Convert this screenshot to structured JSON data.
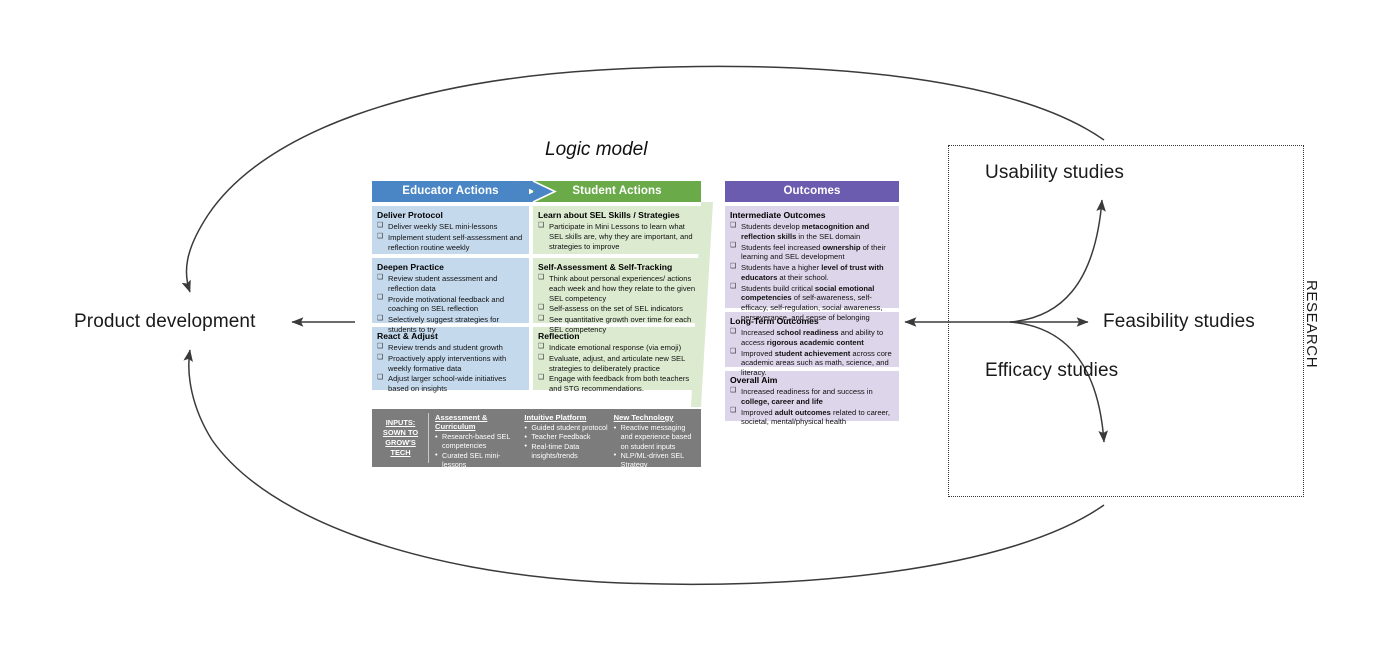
{
  "diagram": {
    "title_logic_model": "Logic model",
    "research_label": "RESEARCH",
    "outer": {
      "product_development": "Product development",
      "usability_studies": "Usability studies",
      "feasibility_studies": "Feasibility studies",
      "efficacy_studies": "Efficacy studies"
    },
    "colors": {
      "educator_header": "#4a86c5",
      "student_header": "#6aaa49",
      "outcomes_header": "#6c5cb0",
      "educator_cell": "#c5d9ed",
      "student_cell": "#dcead0",
      "outcomes_cell": "#ddd5ea",
      "inputs_bar": "#7c7c7c",
      "line": "#3a3a3a"
    }
  },
  "columns": {
    "educator": {
      "header": "Educator Actions",
      "cells": [
        {
          "title": "Deliver Protocol",
          "items": [
            "Deliver weekly SEL mini-lessons",
            "Implement student self-assessment and reflection routine weekly"
          ]
        },
        {
          "title": "Deepen Practice",
          "items": [
            "Review student assessment and reflection data",
            "Provide motivational feedback and coaching on SEL reflection",
            "Selectively suggest strategies for students to try"
          ]
        },
        {
          "title": "React &amp; Adjust",
          "items": [
            "Review trends and student growth",
            "Proactively apply interventions with weekly formative data",
            "Adjust larger school-wide initiatives based on insights"
          ]
        }
      ]
    },
    "student": {
      "header": "Student Actions",
      "cells": [
        {
          "title": "Learn about SEL Skills / Strategies",
          "items": [
            "Participate in Mini Lessons to learn what SEL skills are, why they are important, and strategies to improve"
          ]
        },
        {
          "title": "Self-Assessment &amp; Self-Tracking",
          "items": [
            "Think about personal experiences/ actions each week and how they relate to the given SEL competency",
            "Self-assess on the set of SEL indicators",
            "See quantitative growth over time for each SEL competency"
          ]
        },
        {
          "title": "Reflection",
          "items": [
            "Indicate emotional response (via emoji)",
            "Evaluate, adjust, and articulate new SEL strategies to deliberately practice",
            "Engage with feedback from both teachers and STG recommendations."
          ]
        }
      ]
    },
    "outcomes": {
      "header": "Outcomes",
      "cells": [
        {
          "title": "Intermediate Outcomes",
          "items_html": [
            "Students develop <b>metacognition and reflection skills</b> in the SEL domain",
            "Students feel increased <b>ownership</b> of their learning and SEL development",
            "Students have a higher <b>level of trust with educators</b> at their school.",
            "Students build critical <b>social emotional competencies</b> of self-awareness, self-efficacy, self-regulation, social awareness, perseverance, and sense of belonging"
          ]
        },
        {
          "title": "Long-Term Outcomes",
          "items_html": [
            "Increased <b>school readiness</b> and ability to access <b>rigorous academic content</b>",
            "Improved <b>student achievement</b> across core academic areas such as math, science, and literacy."
          ]
        },
        {
          "title": "Overall Aim",
          "items_html": [
            "Increased readiness for and success in <b>college, career and life</b>",
            "Improved <b>adult outcomes</b> related to career, societal, mental/physical health"
          ]
        }
      ]
    }
  },
  "inputs_bar": {
    "label": "INPUTS: SOWN TO GROW'S TECH",
    "groups": [
      {
        "title": "Assessment &amp; Curriculum",
        "items": [
          "Research-based SEL competencies",
          "Curated SEL mini-lessons"
        ]
      },
      {
        "title": "Intuitive Platform",
        "items": [
          "Guided student protocol",
          "Teacher Feedback",
          "Real-time Data insights/trends"
        ]
      },
      {
        "title": "New Technology",
        "items": [
          "Reactive messaging and experience based on student inputs",
          "NLP/ML-driven SEL Strategy Recommendations"
        ]
      }
    ]
  }
}
